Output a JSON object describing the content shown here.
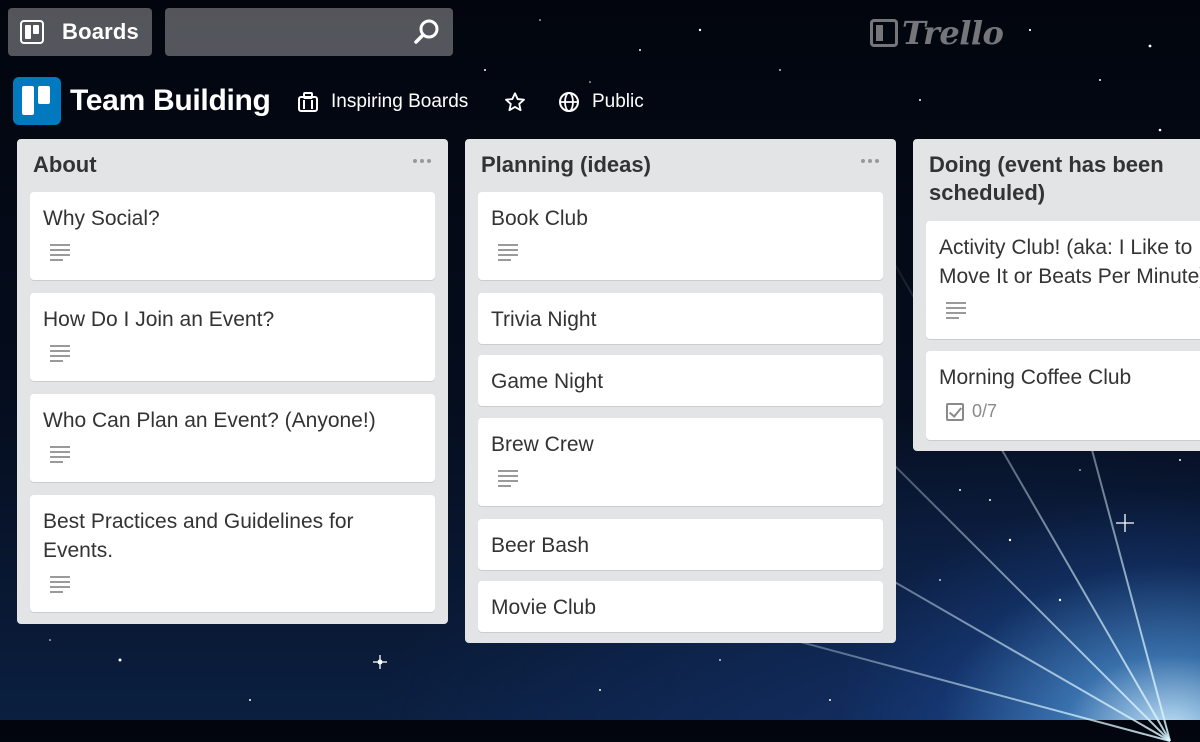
{
  "topbar": {
    "boards_label": "Boards",
    "search_value": "",
    "logo_text": "Trello"
  },
  "board": {
    "title": "Team Building",
    "team_label": "Inspiring Boards",
    "visibility_label": "Public"
  },
  "lists": [
    {
      "title": "About",
      "cards": [
        {
          "title": "Why Social?",
          "badges": [
            "description"
          ]
        },
        {
          "title": "How Do I Join an Event?",
          "badges": [
            "description"
          ]
        },
        {
          "title": "Who Can Plan an Event? (Anyone!)",
          "badges": [
            "description"
          ]
        },
        {
          "title": "Best Practices and Guidelines for Events.",
          "badges": [
            "description"
          ]
        }
      ]
    },
    {
      "title": "Planning (ideas)",
      "cards": [
        {
          "title": "Book Club",
          "badges": [
            "description"
          ]
        },
        {
          "title": "Trivia Night",
          "badges": []
        },
        {
          "title": "Game Night",
          "badges": []
        },
        {
          "title": "Brew Crew",
          "badges": [
            "description"
          ]
        },
        {
          "title": "Beer Bash",
          "badges": []
        },
        {
          "title": "Movie Club",
          "badges": []
        }
      ]
    },
    {
      "title": "Doing (event has been scheduled)",
      "cards": [
        {
          "title": "Activity Club! (aka: I Like to Move It or Beats Per Minute)",
          "badges": [
            "description"
          ]
        },
        {
          "title": "Morning Coffee Club",
          "badges": [
            "checklist"
          ],
          "checklist": "0/7"
        }
      ]
    }
  ],
  "colors": {
    "board_icon": "#0079bf",
    "list_bg": "#e2e4e6",
    "card_bg": "#ffffff"
  }
}
